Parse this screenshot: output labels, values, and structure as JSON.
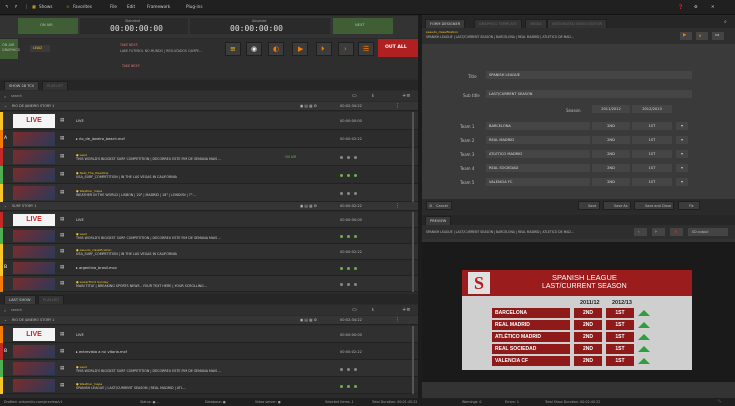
{
  "menu": {
    "shows": "Shows",
    "favorites": "Favorites",
    "file": "File",
    "edit": "Edit",
    "framework": "Framework",
    "plugins": "Plug-ins"
  },
  "topbar": {
    "on_air_label": "ON AIR",
    "timer1_label": "Standard",
    "timer1_value": "00:00:00:00",
    "timer2_label": "Absolute",
    "timer2_value": "00:00:00:00",
    "next_label": "NEXT",
    "on_air_graphics": "ON AIR GRAPHICS",
    "lead_label": "LEAD",
    "take_next_label": "TAKE NEXT:",
    "take_next_value": "LAKE FUTEBOL NO MUNDO | RESULTADOS CAMPE...",
    "out_all": "OUT ALL"
  },
  "playlist1": {
    "tab_show": "SHOW 28 TCV",
    "tab_placeholder": "PLAYLIST",
    "search_placeholder": "search",
    "story_title": "RIO DE JANEIRO STORY 1",
    "story_time": "00:02:34:22",
    "rows": [
      {
        "thumb": "LIVE",
        "title": "LIVE",
        "time": "00:00:00:00"
      },
      {
        "thumb": "img",
        "title": "rio_de_janeiro_beach.mxf",
        "time": "00:00:02:22",
        "marker": "A"
      },
      {
        "thumb": "img",
        "sub": "Lead",
        "title": "THIS WORLD'S BIGGEST SURF COMPETITION | DECORREU ESTE FIM DE SEMANA MAIS ...",
        "badge": "ON AIR"
      },
      {
        "thumb": "img",
        "sub": "Next_The_Headline",
        "title": "USA_SURF_COMPETITION | IN THE LAS VEGAS IN CALIFORNIA"
      },
      {
        "thumb": "img",
        "sub": "Weather_mapa",
        "title": "WEATHER IN THE WORLD | LISBON | 20° | MADRID | 18° | LONDON | 7°..."
      }
    ],
    "story2_title": "SURF STORY 1",
    "story2_time": "00:00:02:22",
    "rows2": [
      {
        "thumb": "LIVE",
        "title": "LIVE",
        "time": "00:00:00:00"
      },
      {
        "sub": "Lead",
        "title": "THIS WORLD'S BIGGEST SURF COMPETITION | DECORREU ESTE FIM DE SEMANA MAIS ..."
      },
      {
        "sub": "pseudo_classification",
        "title": "USA_SURF_COMPETITION | IN THE LAS VEGAS IN CALIFORNIA",
        "time": "00:00:02:22"
      },
      {
        "title": "argentina_brasil.mov",
        "marker": "B"
      },
      {
        "sub": "LowerThird Sunday",
        "title": "MAIN TITLE | BREAKING SPORTS NEWS - YOUR TEXT HERE | YOUR SCROLLING..."
      }
    ]
  },
  "playlist2": {
    "tab_show": "LAST SHOW",
    "tab_placeholder": "PLAYLIST",
    "search_placeholder": "search",
    "story_title": "RIO DE JANEIRO STORY 1",
    "story_time": "00:02:34:22",
    "rows": [
      {
        "thumb": "LIVE",
        "title": "LIVE",
        "time": "00:00:00:00"
      },
      {
        "title": "entrevista a rui vitoria.mxf",
        "time": "00:00:02:22",
        "marker": "B"
      },
      {
        "sub": "Lead",
        "title": "THIS WORLD'S BIGGEST SURF COMPETITION | DECORREU ESTE FIM DE SEMANA MAIS ..."
      },
      {
        "sub": "Weather_mapa",
        "title": "SPANISH LEAGUE | LAST/CURRENT SEASON | REAL MADRID | ATL..."
      }
    ]
  },
  "form": {
    "tab_active": "FORM DESIGNER",
    "tab2": "GRAPHICS TEMPLATE",
    "tab3": "MEDIA",
    "tab4": "INTEGRATED VIDEO EDITOR",
    "template_sub": "pseudo_classification",
    "template_path": "SPANISH LEAGUE | LAST/CURRENT SEASON | BARCELONA | REAL MADRID | ATLETICO DE MAD...",
    "title_label": "Title",
    "title_value": "SPANISH LEAGUE",
    "subtitle_label": "Sub title",
    "subtitle_value": "LAST/CURRENT SEASON",
    "season_label": "Season",
    "season1": "2011/2012",
    "season2": "2012/2013",
    "teams": [
      {
        "label": "Team 1",
        "name": "BARCELONA",
        "s1": "2ND",
        "s2": "1ST"
      },
      {
        "label": "Team 2",
        "name": "REAL MADRID",
        "s1": "2ND",
        "s2": "1ST"
      },
      {
        "label": "Team 3",
        "name": "ATLETICO MADRID",
        "s1": "2ND",
        "s2": "1ST"
      },
      {
        "label": "Team 4",
        "name": "REAL SOCIEDAD",
        "s1": "2ND",
        "s2": "1ST"
      },
      {
        "label": "Team 5",
        "name": "VALENCIA FC",
        "s1": "2ND",
        "s2": "1ST"
      }
    ],
    "cancel": "Cancel",
    "save": "Save",
    "save_as": "Save As",
    "save_close": "Save and Close",
    "fix": "Fix"
  },
  "preview": {
    "tab": "PREVIEW",
    "path": "SPANISH LEAGUE | LAST/CURRENT SEASON | BARCELONA | REAL MADRID | ATLETICO DE MAD...",
    "output": "SD output",
    "gfx_title": "SPANISH LEAGUE",
    "gfx_subtitle": "LAST/CURRENT SEASON",
    "col1": "2011/12",
    "col2": "2012/13",
    "teams": [
      {
        "name": "BARCELONA",
        "s1": "2ND",
        "s2": "1ST"
      },
      {
        "name": "REAL MADRID",
        "s1": "2ND",
        "s2": "1ST"
      },
      {
        "name": "ATLÉTICO MADRID",
        "s1": "2ND",
        "s2": "1ST"
      },
      {
        "name": "REAL SOCIEDAD",
        "s1": "2ND",
        "s2": "1ST"
      },
      {
        "name": "VALENCIA CF",
        "s1": "2ND",
        "s2": "1ST"
      }
    ]
  },
  "statusbar": {
    "left": "Drafted: ontuemlix.com/preview/v1",
    "status": "Status: ● --",
    "database": "Database: ●",
    "video_server": "Video server: ●",
    "selected_items": "Selected items: 1",
    "total_duration": "Total Duration: 00:01:45:22",
    "warnings": "Warnings: 0",
    "errors": "Errors: 1",
    "total_show_duration": "Total Show Duration: 00:02:45:22"
  },
  "colors": {
    "accent_red": "#c62828",
    "accent_orange": "#f57c00",
    "accent_yellow": "#f9c623",
    "on_air_green": "#4c7a37"
  }
}
